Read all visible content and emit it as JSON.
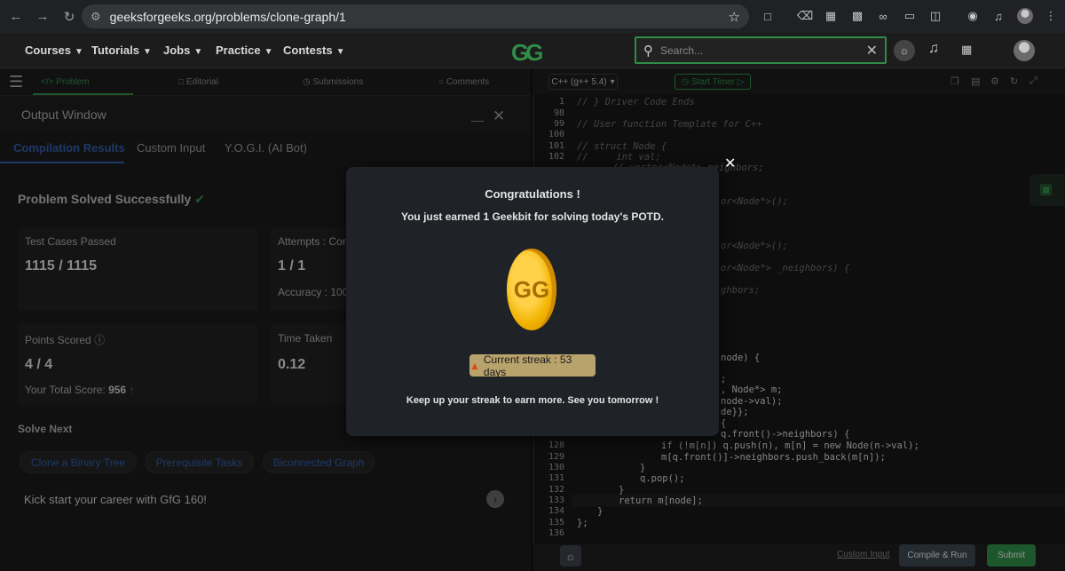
{
  "browser": {
    "url": "geeksforgeeks.org/problems/clone-graph/1"
  },
  "header": {
    "logo": "GG",
    "menu": [
      "Courses",
      "Tutorials",
      "Jobs",
      "Practice",
      "Contests"
    ],
    "search_placeholder": "Search..."
  },
  "tabs": [
    "Problem",
    "Editorial",
    "Submissions",
    "Comments"
  ],
  "output": {
    "title": "Output Window",
    "subtabs": [
      "Compilation Results",
      "Custom Input",
      "Y.O.G.I. (AI Bot)"
    ],
    "status": "Problem Solved Successfully",
    "cards": {
      "test_cases_label": "Test Cases Passed",
      "test_cases_value": "1115 / 1115",
      "attempts_label": "Attempts : Corr",
      "attempts_value": "1 / 1",
      "accuracy_label": "Accuracy : 100",
      "points_label": "Points Scored",
      "points_value": "4 / 4",
      "total_score_label": "Your Total Score:",
      "total_score_value": "956",
      "time_label": "Time Taken",
      "time_value": "0.12"
    },
    "solve_next_title": "Solve Next",
    "solve_next": [
      "Clone a Binary Tree",
      "Prerequisite Tasks",
      "Biconnected Graph"
    ],
    "banner": "Kick start your career with GfG 160!"
  },
  "editor": {
    "language": "C++ (g++ 5.4)",
    "timer": "Start Timer",
    "line_numbers": [
      "1",
      "98",
      "99",
      "100",
      "101",
      "102",
      "128",
      "129",
      "130",
      "131",
      "132",
      "133",
      "134",
      "135",
      "136"
    ],
    "lines": {
      "l1": "// } Driver Code Ends",
      "l99": "// User function Template for C++",
      "l101": "// struct Node {",
      "l102": "//     int val;",
      "f1": "// vector<Node*> neighbors;",
      "f2": "or<Node*>();",
      "f3": "or<Node*>();",
      "f4": "or<Node*> _neighbors) {",
      "f5": "ghbors;",
      "f6": "node) {",
      "f7": ";",
      "f8": ", Node*> m;",
      "f9": "node->val);",
      "f10": "de}};",
      "f11": "{",
      "f12": "q.front()->neighbors) {",
      "l128": "if (!m[n]) q.push(n), m[n] = new Node(n->val);",
      "l129": "m[q.front()]->neighbors.push_back(m[n]);",
      "l130": "}",
      "l131": "q.pop();",
      "l132": "}",
      "l133": "return m[node];",
      "l134": "}",
      "l135": "};"
    },
    "custom_input": "Custom Input",
    "compile_run": "Compile & Run",
    "submit": "Submit"
  },
  "modal": {
    "title": "Congratulations !",
    "subtitle": "You just earned 1 Geekbit for solving today's POTD.",
    "coin": "GG",
    "streak": "Current streak : 53 days",
    "footer": "Keep up your streak to earn more. See you tomorrow !"
  },
  "colors": {
    "brand_green": "#2f8d46",
    "streak_bg": "#b9a36c"
  }
}
